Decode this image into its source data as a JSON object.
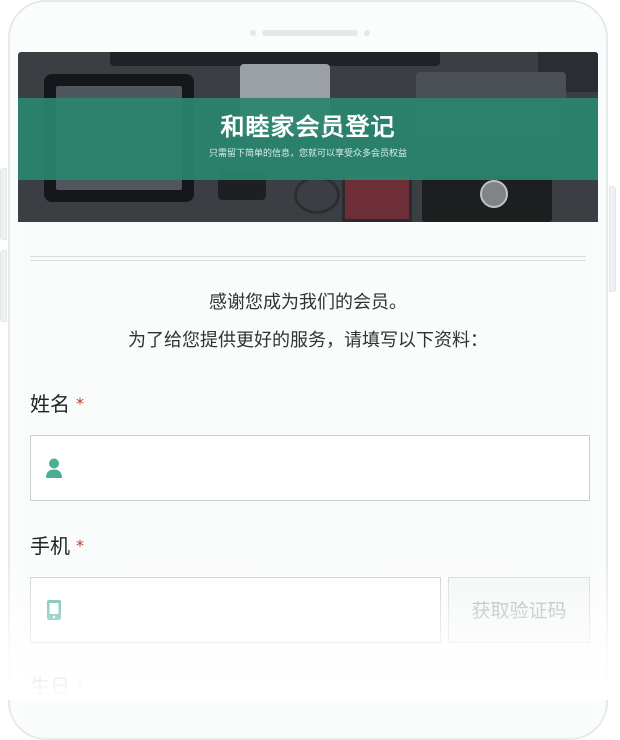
{
  "banner": {
    "title": "和睦家会员登记",
    "subtitle": "只需留下简单的信息，您就可以享受众多会员权益"
  },
  "intro": {
    "line1": "感谢您成为我们的会员。",
    "line2": "为了给您提供更好的服务，请填写以下资料："
  },
  "form": {
    "name": {
      "label": "姓名",
      "required_mark": "*",
      "icon": "user-icon"
    },
    "phone": {
      "label": "手机",
      "required_mark": "*",
      "icon": "mobile-phone-icon",
      "code_button": "获取验证码"
    },
    "birthday": {
      "label": "生日",
      "required_mark": "*"
    }
  },
  "colors": {
    "accent": "#2a856e",
    "required": "#c0392b",
    "icon": "#4cae97"
  }
}
